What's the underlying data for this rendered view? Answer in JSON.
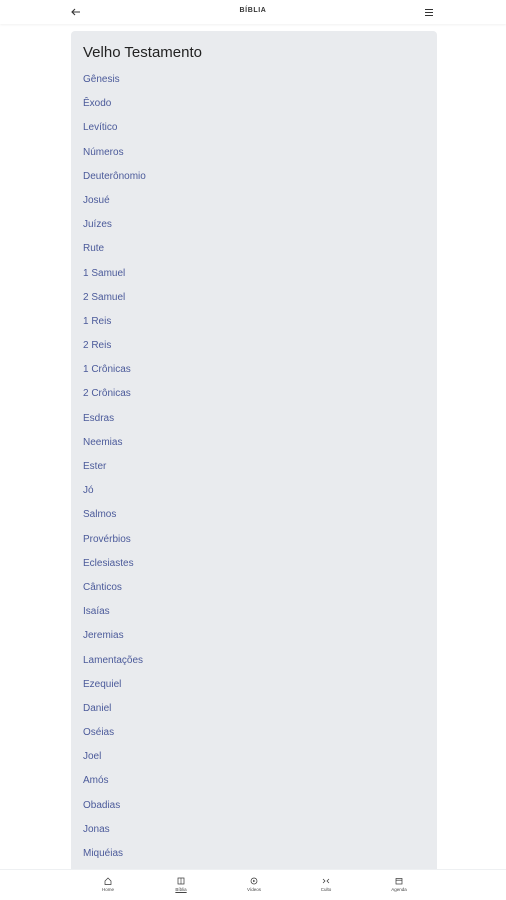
{
  "header": {
    "title": "BÍBLIA",
    "back_icon": "arrow-left-icon",
    "menu_icon": "hamburger-menu-icon"
  },
  "card": {
    "heading": "Velho Testamento",
    "books": [
      "Gênesis",
      "Êxodo",
      "Levítico",
      "Números",
      "Deuterônomio",
      "Josué",
      "Juízes",
      "Rute",
      "1 Samuel",
      "2 Samuel",
      "1 Reis",
      "2 Reis",
      "1 Crônicas",
      "2 Crônicas",
      "Esdras",
      "Neemias",
      "Ester",
      "Jó",
      "Salmos",
      "Provérbios",
      "Eclesiastes",
      "Cânticos",
      "Isaías",
      "Jeremias",
      "Lamentações",
      "Ezequiel",
      "Daniel",
      "Oséias",
      "Joel",
      "Amós",
      "Obadias",
      "Jonas",
      "Miquéias"
    ]
  },
  "bottom_nav": {
    "items": [
      {
        "label": "Home",
        "icon": "home-icon"
      },
      {
        "label": "Bíblia",
        "icon": "book-icon",
        "active": true
      },
      {
        "label": "Vídeos",
        "icon": "video-icon"
      },
      {
        "label": "Culto",
        "icon": "culto-icon"
      },
      {
        "label": "Agenda",
        "icon": "calendar-icon"
      }
    ]
  },
  "colors": {
    "link": "#4b5a9a",
    "card_bg": "#e9ebee"
  }
}
